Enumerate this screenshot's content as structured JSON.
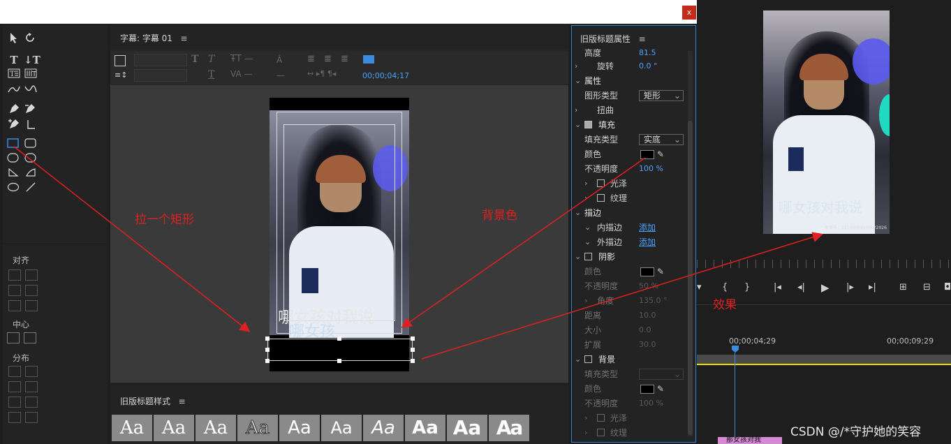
{
  "window": {
    "close_label": "x"
  },
  "title_editor": {
    "tab_title": "字幕: 字幕 01",
    "timecode": "00;00;04;17",
    "caption_text": "哪女孩对我说",
    "caption_sub": "哪女孩"
  },
  "align_panel": {
    "align_label": "对齐",
    "center_label": "中心",
    "distribute_label": "分布"
  },
  "styles_panel": {
    "title": "旧版标题样式",
    "swatches": [
      "Aa",
      "Aa",
      "Aa",
      "Aa",
      "Aa",
      "Aa",
      "Aa",
      "Aa",
      "Aa",
      "Aa"
    ]
  },
  "properties": {
    "title": "旧版标题属性",
    "height_label": "高度",
    "height_value": "81.5",
    "rotation_label": "旋转",
    "rotation_value": "0.0 °",
    "attributes_label": "属性",
    "shape_type_label": "图形类型",
    "shape_type_value": "矩形",
    "distort_label": "扭曲",
    "fill_label": "填充",
    "fill_type_label": "填充类型",
    "fill_type_value": "实底",
    "color_label": "颜色",
    "opacity_label": "不透明度",
    "opacity_value": "100 %",
    "sheen_label": "光泽",
    "texture_label": "纹理",
    "stroke_label": "描边",
    "inner_stroke_label": "内描边",
    "outer_stroke_label": "外描边",
    "add_label": "添加",
    "shadow_label": "阴影",
    "shadow_color_label": "颜色",
    "shadow_opacity_label": "不透明度",
    "shadow_opacity_value": "50 %",
    "angle_label": "角度",
    "angle_value": "135.0 °",
    "distance_label": "距离",
    "distance_value": "10.0",
    "size_label": "大小",
    "size_value": "0.0",
    "spread_label": "扩展",
    "spread_value": "30.0",
    "background_label": "背景",
    "bg_fill_type_label": "填充类型",
    "bg_color_label": "颜色",
    "bg_opacity_label": "不透明度",
    "bg_opacity_value": "100 %",
    "bg_sheen_label": "光泽",
    "bg_texture_label": "纹理"
  },
  "program_monitor": {
    "caption_text": "哪女孩对我说",
    "record_number": "备案号：19100064190822026"
  },
  "timeline": {
    "timecode_a": "00;00;04;29",
    "timecode_b": "00;00;09;29",
    "clip_label": "那女孩对我"
  },
  "annotations": {
    "draw_rect": "拉一个矩形",
    "bg_color": "背景色",
    "effect": "效果"
  },
  "watermark": "CSDN @/*守护她的笑容",
  "colors": {
    "accent": "#4aa3ff",
    "annotation": "#e02020",
    "panel_border": "#2f7fd0"
  }
}
